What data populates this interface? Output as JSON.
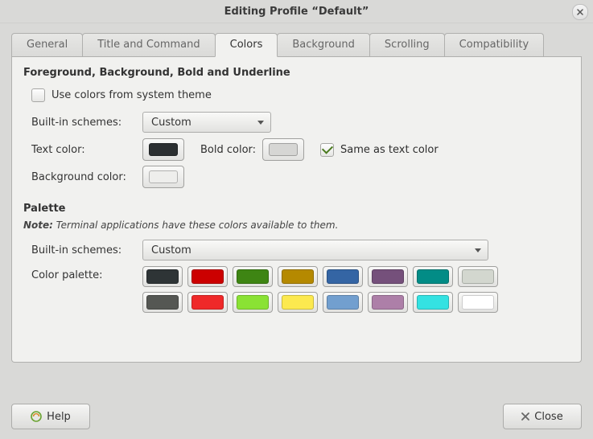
{
  "title": "Editing Profile “Default”",
  "tabs": [
    {
      "label": "General"
    },
    {
      "label": "Title and Command"
    },
    {
      "label": "Colors"
    },
    {
      "label": "Background"
    },
    {
      "label": "Scrolling"
    },
    {
      "label": "Compatibility"
    }
  ],
  "active_tab": "Colors",
  "fgbg": {
    "heading": "Foreground, Background, Bold and Underline",
    "use_system_label": "Use colors from system theme",
    "use_system_checked": false,
    "builtin_label": "Built-in schemes:",
    "builtin_value": "Custom",
    "text_color_label": "Text color:",
    "text_color_value": "#2b2f31",
    "bold_color_label": "Bold color:",
    "bold_color_value": "#d6d6d4",
    "same_as_text_label": "Same as text color",
    "same_as_text_checked": true,
    "background_color_label": "Background color:",
    "background_color_value": "#eeeeec"
  },
  "palette": {
    "heading": "Palette",
    "note_label": "Note:",
    "note_text": "Terminal applications have these colors available to them.",
    "builtin_label": "Built-in schemes:",
    "builtin_value": "Custom",
    "grid_label": "Color palette:",
    "colors": [
      "#2e3436",
      "#cc0000",
      "#3e8513",
      "#b58900",
      "#3465a4",
      "#75507b",
      "#028c86",
      "#d3d7cf",
      "#555753",
      "#ef2929",
      "#8ae234",
      "#fce94f",
      "#729fcf",
      "#ad7fa8",
      "#34e2e2",
      "#ffffff"
    ]
  },
  "footer": {
    "help": "Help",
    "close": "Close"
  }
}
